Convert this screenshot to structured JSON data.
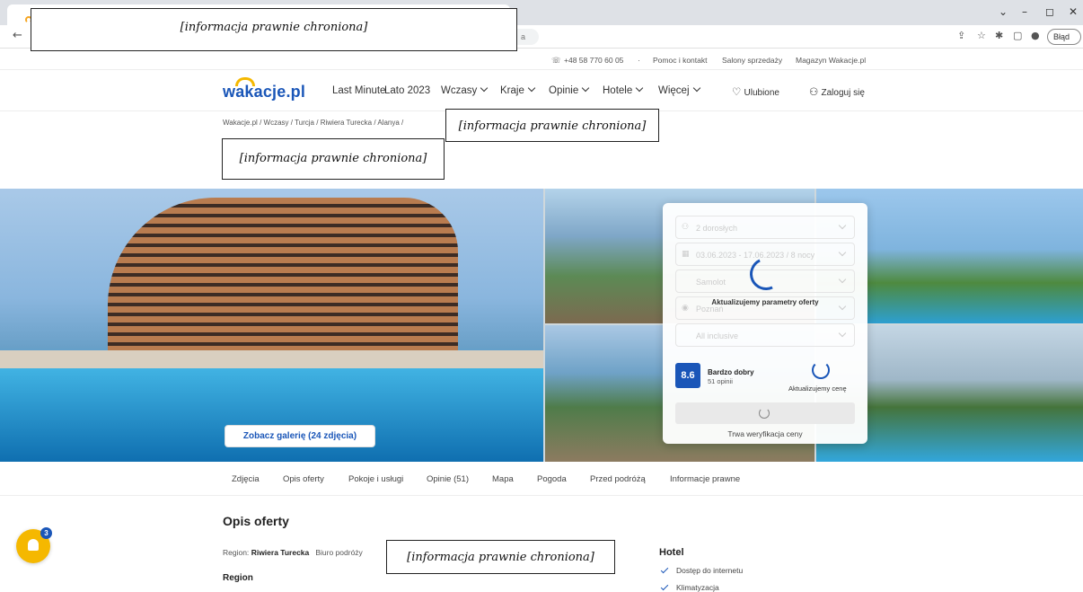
{
  "browser": {
    "window_controls": {
      "minimize": "–",
      "restore": "◻",
      "close": "✕",
      "dropdown": "⌄"
    },
    "back": "←",
    "url_tail": "a",
    "error_label": "Błąd",
    "toolbar_icons": [
      "share-icon",
      "star-icon",
      "extensions-icon",
      "sidepanel-icon",
      "profile-icon"
    ]
  },
  "redactions": {
    "label": "[informacja prawnie chroniona]"
  },
  "infobar": {
    "phone": "+48 58 770 60 05",
    "separator": "·",
    "help": "Pomoc i kontakt",
    "salons": "Salony sprzedaży",
    "magazine": "Magazyn Wakacje.pl"
  },
  "nav": {
    "logo": "wakacje.pl",
    "items": [
      {
        "label": "Last Minute",
        "dropdown": false
      },
      {
        "label": "Lato 2023",
        "dropdown": false
      },
      {
        "label": "Wczasy",
        "dropdown": true
      },
      {
        "label": "Kraje",
        "dropdown": true
      },
      {
        "label": "Opinie",
        "dropdown": true
      },
      {
        "label": "Hotele",
        "dropdown": true
      },
      {
        "label": "Więcej",
        "dropdown": true
      }
    ],
    "favorites": "Ulubione",
    "login": "Zaloguj się"
  },
  "breadcrumb": {
    "items": [
      "Wakacje.pl",
      "Wczasy",
      "Turcja",
      "Riwiera Turecka",
      "Alanya"
    ],
    "separator": "/"
  },
  "gallery": {
    "button": "Zobacz galerię (24 zdjęcia)"
  },
  "widget": {
    "fields": [
      {
        "icon": "person-icon",
        "value": "2 dorosłych"
      },
      {
        "icon": "calendar-icon",
        "value": "03.06.2023 - 17.06.2023 / 8 nocy"
      },
      {
        "icon": "",
        "value": "Samolot"
      },
      {
        "icon": "pin-icon",
        "value": "Poznań"
      },
      {
        "icon": "",
        "value": "All inclusive"
      }
    ],
    "updating_params": "Aktualizujemy parametry oferty",
    "score": "8.6",
    "score_label": "Bardzo dobry",
    "score_count": "51 opinii",
    "updating_price": "Aktualizujemy cenę",
    "verifying": "Trwa weryfikacja ceny"
  },
  "section_tabs": [
    "Zdjęcia",
    "Opis oferty",
    "Pokoje i usługi",
    "Opinie (51)",
    "Mapa",
    "Pogoda",
    "Przed podróżą",
    "Informacje prawne"
  ],
  "content": {
    "heading": "Opis oferty",
    "region_label": "Region:",
    "region_value": "Riwiera Turecka",
    "agency_label": "Biuro podróży",
    "region_heading": "Region",
    "hotel_heading": "Hotel",
    "hotel_features": [
      "Dostęp do internetu",
      "Klimatyzacja"
    ]
  },
  "notifications": {
    "badge_count": "3"
  },
  "colors": {
    "brand_blue": "#1a56b8",
    "brand_yellow": "#f5b800"
  }
}
